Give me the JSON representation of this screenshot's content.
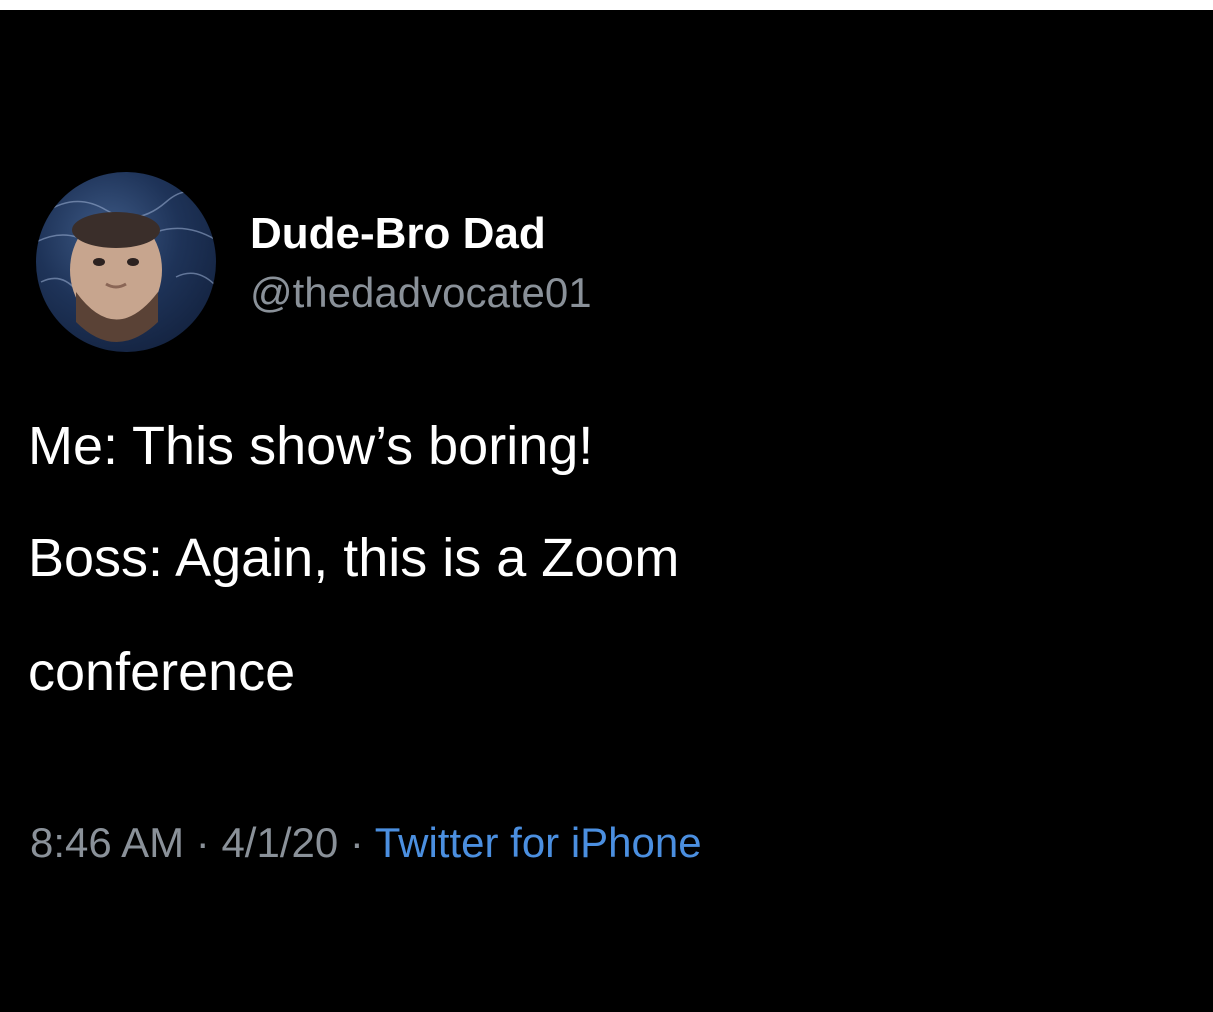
{
  "tweet": {
    "display_name": "Dude-Bro Dad",
    "handle": "@thedadvocate01",
    "lines": [
      "Me: This show’s boring!",
      "Boss: Again, this is a Zoom",
      "conference"
    ],
    "time": "8:46 AM",
    "separator": " · ",
    "date": "4/1/20",
    "source": "Twitter for iPhone"
  },
  "colors": {
    "background": "#000000",
    "text": "#ffffff",
    "secondary": "#8a9199",
    "link": "#4b8fe0"
  }
}
